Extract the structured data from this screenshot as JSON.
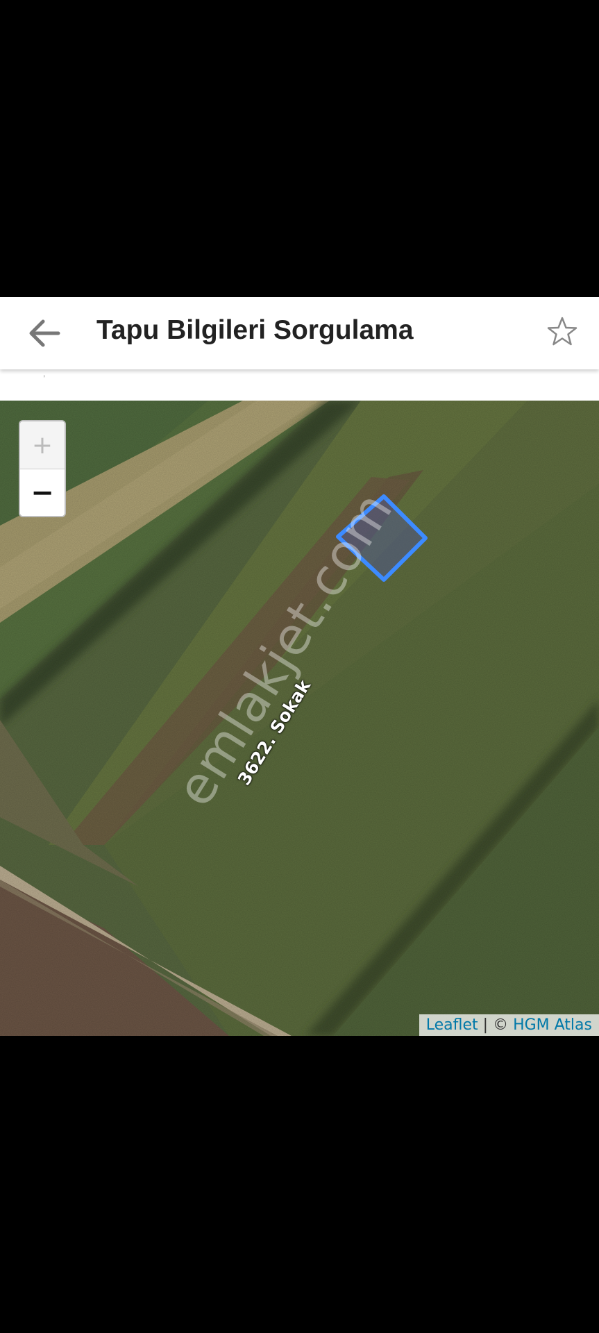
{
  "header": {
    "title": "Tapu Bilgileri Sorgulama",
    "back_icon": "arrow-left-icon",
    "favorite_icon": "star-outline-icon"
  },
  "map": {
    "zoom_in_label": "+",
    "zoom_out_label": "−",
    "street_label": "3622. Sokak",
    "watermark": "emlakjet.com",
    "attribution": {
      "leaflet": "Leaflet",
      "separator": " | © ",
      "provider": "HGM Atlas"
    },
    "parcel_outline_color": "#3d8bff"
  }
}
